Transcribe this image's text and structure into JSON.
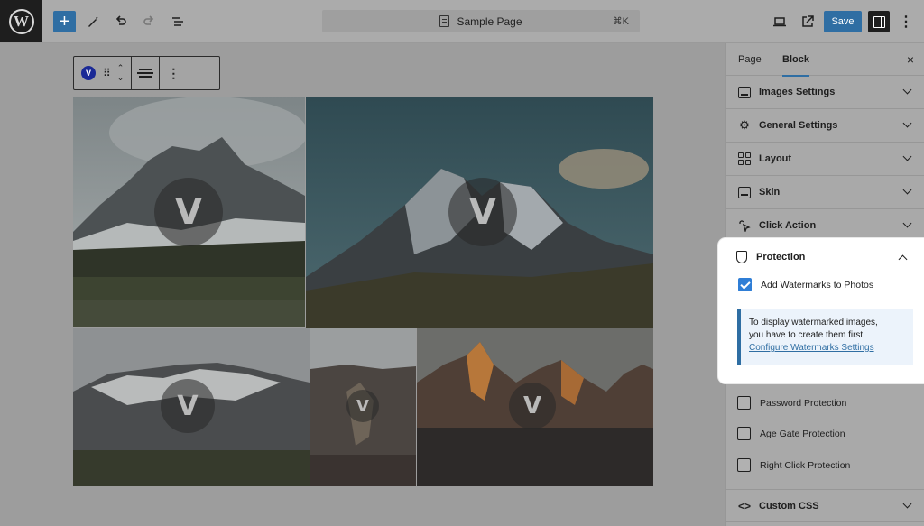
{
  "topbar": {
    "logo_letter": "W",
    "add_label": "+",
    "page_title": "Sample Page",
    "shortcut": "⌘K",
    "save_label": "Save",
    "more_label": "⋮"
  },
  "block_toolbar": {
    "block_logo": "V",
    "drag_label": "⠿",
    "move_up": "⌃",
    "move_down": "⌄",
    "more_label": "⋮"
  },
  "gallery": {
    "watermark_letter": "V"
  },
  "sidebar": {
    "tabs": [
      {
        "label": "Page"
      },
      {
        "label": "Block"
      }
    ],
    "close_label": "×",
    "panels": [
      {
        "label": "Images Settings",
        "icon": "image-icon"
      },
      {
        "label": "General Settings",
        "icon": "gear-icon"
      },
      {
        "label": "Layout",
        "icon": "layout-grid-icon"
      },
      {
        "label": "Skin",
        "icon": "skin-icon"
      },
      {
        "label": "Click Action",
        "icon": "pointer-click-icon"
      }
    ],
    "protection": {
      "label": "Protection",
      "watermark_checkbox": "Add Watermarks to Photos",
      "watermark_checked": true,
      "notice_line1": "To display watermarked images,",
      "notice_line2": "you have to create them first:",
      "notice_link": "Configure Watermarks Settings"
    },
    "options": [
      {
        "label": "Password Protection",
        "checked": false
      },
      {
        "label": "Age Gate Protection",
        "checked": false
      },
      {
        "label": "Right Click Protection",
        "checked": false
      }
    ],
    "custom_css": {
      "label": "Custom CSS",
      "icon": "code-icon"
    }
  },
  "colors": {
    "accent": "#2f6ea3",
    "checkbox_checked": "#2f7ed6",
    "notice_bg": "#ecf3fb"
  }
}
